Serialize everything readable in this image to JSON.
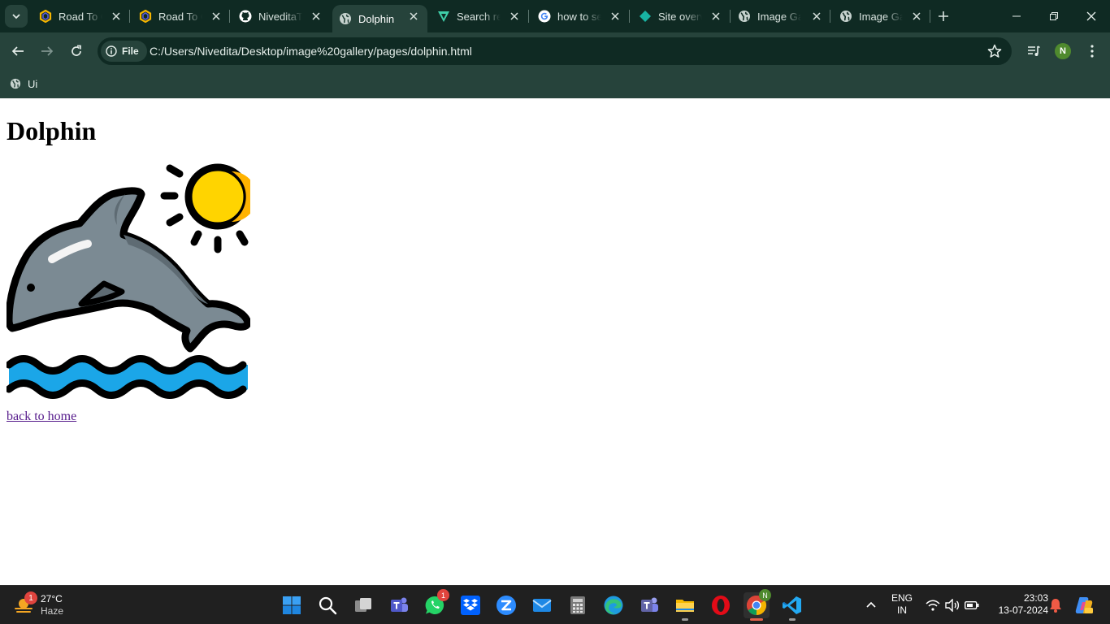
{
  "browser": {
    "tabs": [
      {
        "title": "Road To C",
        "icon": "hexagon-favicon-icon",
        "active": false
      },
      {
        "title": "Road To C",
        "icon": "hexagon-favicon-icon",
        "active": false
      },
      {
        "title": "NiveditaT",
        "icon": "github-icon",
        "active": false
      },
      {
        "title": "Dolphin",
        "icon": "globe-icon",
        "active": true
      },
      {
        "title": "Search re",
        "icon": "vercel-v-icon",
        "active": false
      },
      {
        "title": "how to se",
        "icon": "google-icon",
        "active": false
      },
      {
        "title": "Site overv",
        "icon": "diamond-icon",
        "active": false
      },
      {
        "title": "Image Ga",
        "icon": "globe-icon",
        "active": false
      },
      {
        "title": "Image Ga",
        "icon": "globe-icon",
        "active": false
      }
    ],
    "chip_label": "File",
    "url": "C:/Users/Nivedita/Desktop/image%20gallery/pages/dolphin.html",
    "profile_initial": "N",
    "bookmark_label": "Ui"
  },
  "page": {
    "heading": "Dolphin",
    "image_subject": "dolphin-jumping-with-sun-and-waves",
    "link_text": "back to home",
    "colors": {
      "sun": "#ffd400",
      "dolphin": "#7b8a93",
      "water": "#1ba6e8",
      "link": "#551a8b"
    }
  },
  "taskbar": {
    "weather_temp": "27°C",
    "weather_desc": "Haze",
    "weather_badge": "1",
    "whatsapp_badge": "1",
    "chrome_badge": "N",
    "lang_line1": "ENG",
    "lang_line2": "IN",
    "time": "23:03",
    "date": "13-07-2024"
  },
  "theme": {
    "tabbar_bg": "#0f2a23",
    "toolbar_bg": "#26433b",
    "taskbar_bg": "#202020"
  }
}
